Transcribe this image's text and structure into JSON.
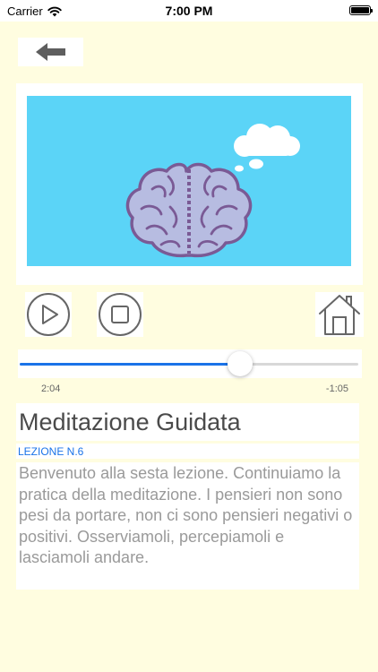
{
  "status_bar": {
    "carrier": "Carrier",
    "time": "7:00 PM"
  },
  "navigation": {
    "back_icon": "arrow-left-icon"
  },
  "media": {
    "illustration": "brain-thinking-cloud",
    "background_color": "#5BD4F7"
  },
  "controls": {
    "play_icon": "play-icon",
    "stop_icon": "stop-icon",
    "home_icon": "home-icon"
  },
  "player": {
    "elapsed": "2:04",
    "remaining": "-1:05",
    "progress": 0.65,
    "accent_color": "#1A73E8"
  },
  "content": {
    "title": "Meditazione Guidata",
    "lesson": "LEZIONE N.6",
    "description": "Benvenuto alla sesta lezione. Continuiamo la pratica della meditazione. I pensieri non sono pesi da portare, non ci sono pensieri negativi o positivi. Osserviamoli, percepiamoli e lasciamoli andare."
  }
}
